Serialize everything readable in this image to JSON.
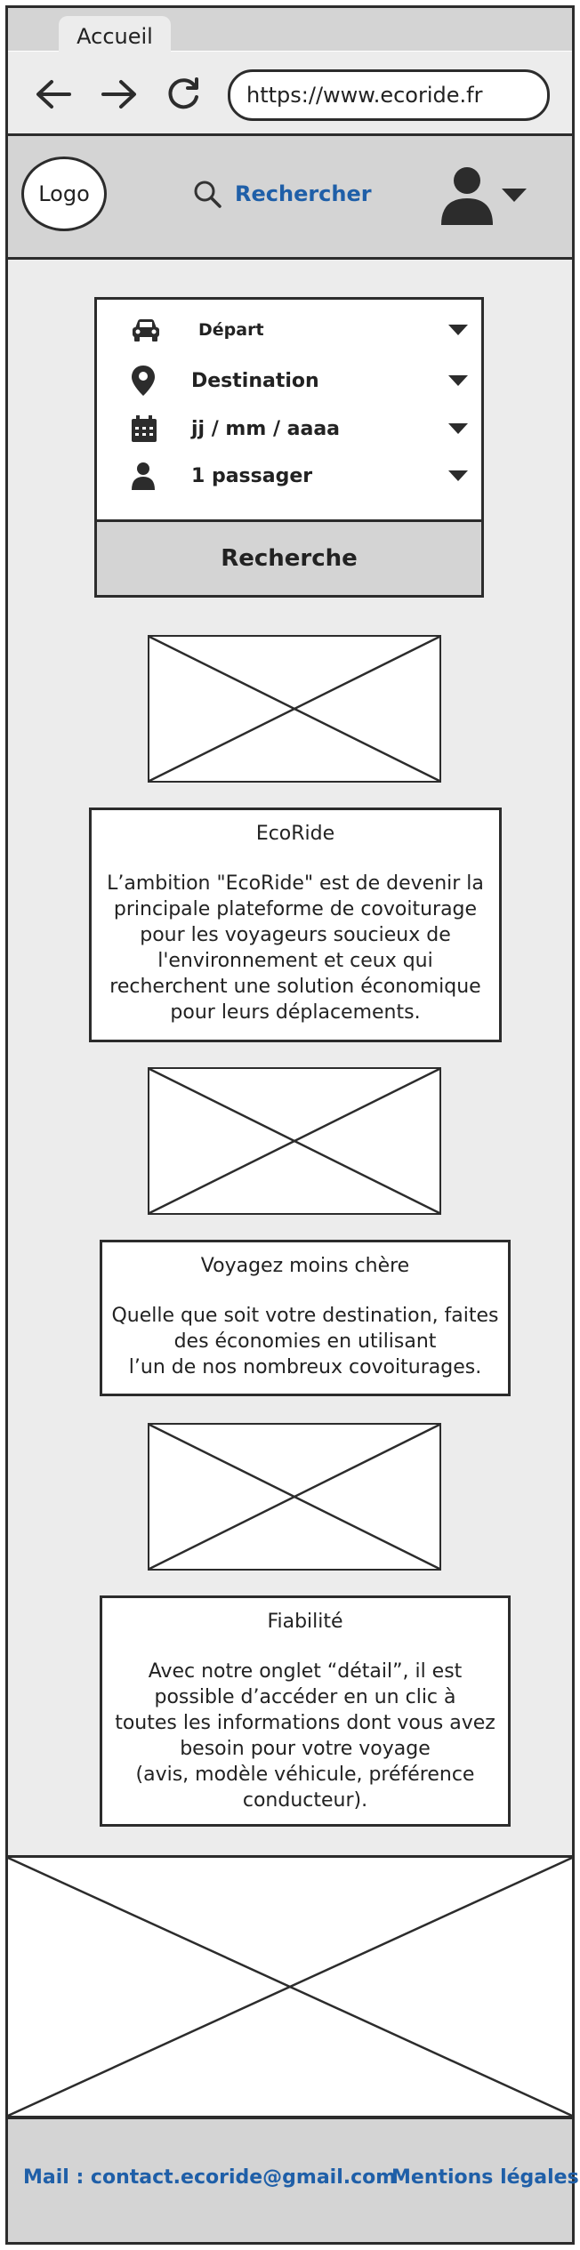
{
  "browser": {
    "tab_label": "Accueil",
    "url": "https://www.ecoride.fr",
    "back_icon": "arrow-left-icon",
    "forward_icon": "arrow-right-icon",
    "reload_icon": "reload-icon"
  },
  "header": {
    "logo_label": "Logo",
    "search_label": "Rechercher",
    "search_icon": "search-icon",
    "user_icon": "user-icon",
    "link_color": "#1f5fa8"
  },
  "search_form": {
    "fields": [
      {
        "label": "Départ",
        "icon": "car-icon"
      },
      {
        "label": "Destination",
        "icon": "map-pin-icon"
      },
      {
        "label": "jj / mm / aaaa",
        "icon": "calendar-icon"
      },
      {
        "label": "1 passager",
        "icon": "person-icon"
      }
    ],
    "submit_label": "Recherche"
  },
  "sections": [
    {
      "title": "EcoRide",
      "body": "L’ambition \"EcoRide\" est de devenir la\nprincipale plateforme de covoiturage\npour les voyageurs soucieux de\nl'environnement et ceux qui\nrecherchent une solution économique\npour leurs déplacements."
    },
    {
      "title": "Voyagez moins chère",
      "body": "Quelle que soit votre destination, faites\ndes économies en utilisant\nl’un de nos nombreux covoiturages."
    },
    {
      "title": "Fiabilité",
      "body": "Avec notre onglet “détail”, il est\npossible d’accéder en un clic à\ntoutes les informations dont vous avez\nbesoin pour votre voyage\n(avis, modèle véhicule, préférence\nconducteur)."
    }
  ],
  "footer": {
    "mail_label": "Mail : contact.ecoride@gmail.com",
    "legal_label": "Mentions légales"
  },
  "colors": {
    "header_bg": "#d4d4d4",
    "page_bg": "#ececec",
    "link": "#1f5fa8"
  }
}
